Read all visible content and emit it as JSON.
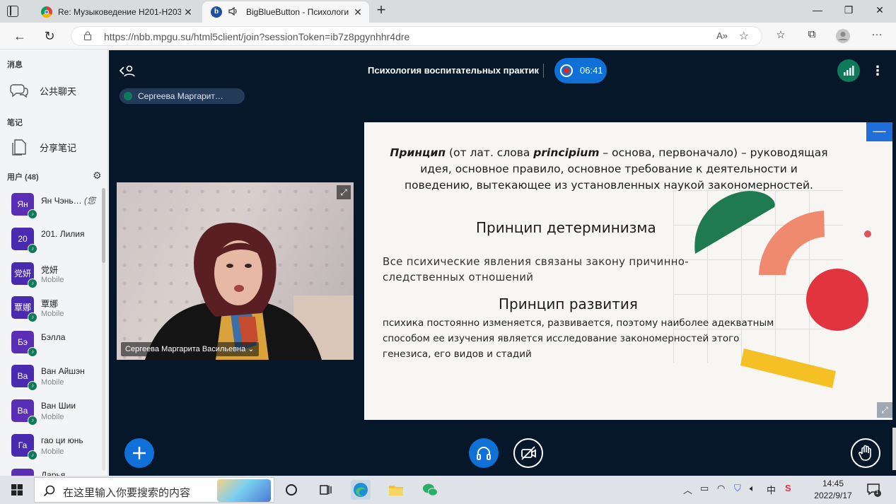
{
  "browser": {
    "tabs": [
      {
        "title": "Re: Музыковедение Н201-Н203",
        "active": false
      },
      {
        "title": "BigBlueButton - Психологи",
        "active": true
      }
    ],
    "url": "https://nbb.mpgu.su/html5client/join?sessionToken=ib7z8pgynhhr4dre",
    "read_aloud_glyph": "A»"
  },
  "sidebar": {
    "messages_header": "消息",
    "public_chat": "公共聊天",
    "notes_header": "笔记",
    "shared_notes": "分享笔记",
    "users_header": "用户 (48)",
    "users": [
      {
        "initials": "Ян",
        "name": "Ян Чэнь…",
        "extra": "(您",
        "sub": ""
      },
      {
        "initials": "20",
        "name": "201. Лилия",
        "extra": "",
        "sub": ""
      },
      {
        "initials": "党妍",
        "name": "党妍",
        "extra": "",
        "sub": "Mobile"
      },
      {
        "initials": "覃娜",
        "name": "覃娜",
        "extra": "",
        "sub": "Mobile"
      },
      {
        "initials": "Бэ",
        "name": "Бэлла",
        "extra": "",
        "sub": ""
      },
      {
        "initials": "Ва",
        "name": "Ван Айшэн",
        "extra": "",
        "sub": "Mobile"
      },
      {
        "initials": "Ва",
        "name": "Ван Шии",
        "extra": "",
        "sub": "Mobile"
      },
      {
        "initials": "Га",
        "name": "гао ци юнь",
        "extra": "",
        "sub": "Mobile"
      },
      {
        "initials": "",
        "name": "Дарья",
        "extra": "",
        "sub": ""
      }
    ]
  },
  "meeting": {
    "title": "Психология воспитательных практик",
    "recording_time": "06:41",
    "talker": "Сергеева Маргарит…",
    "webcam_name": "Сергеева Маргарита Васильевна"
  },
  "slide": {
    "definition_term": "Принцип",
    "definition_mid": " (от лат. слова ",
    "definition_latin": "principium",
    "definition_rest": " – основа, первоначало) – руководящая идея, основное правило, основное требование к деятельности и поведению, вытекающее из установленных наукой закономерностей.",
    "heading_determinism": "Принцип детерминизма",
    "text_determinism": "Все психические явления связаны закону причинно-следственных отношений",
    "heading_development": "Принцип развития",
    "text_development": "психика постоянно изменяется, развивается, поэтому наиболее адекватным способом ее изучения является исследование закономерностей этого генезиса, его видов и стадий"
  },
  "taskbar": {
    "search_placeholder": "在这里输入你要搜索的内容",
    "time": "14:45",
    "date": "2022/9/17",
    "ime": "中",
    "notifications": "1"
  },
  "colors": {
    "bbb_background": "#06172a",
    "bbb_primary": "#0f70d7",
    "recording_red": "#df2721",
    "shape_green": "#1f7a4f",
    "shape_salmon": "#ef8a6f",
    "shape_red": "#e2343f",
    "shape_yellow": "#f5c023"
  }
}
